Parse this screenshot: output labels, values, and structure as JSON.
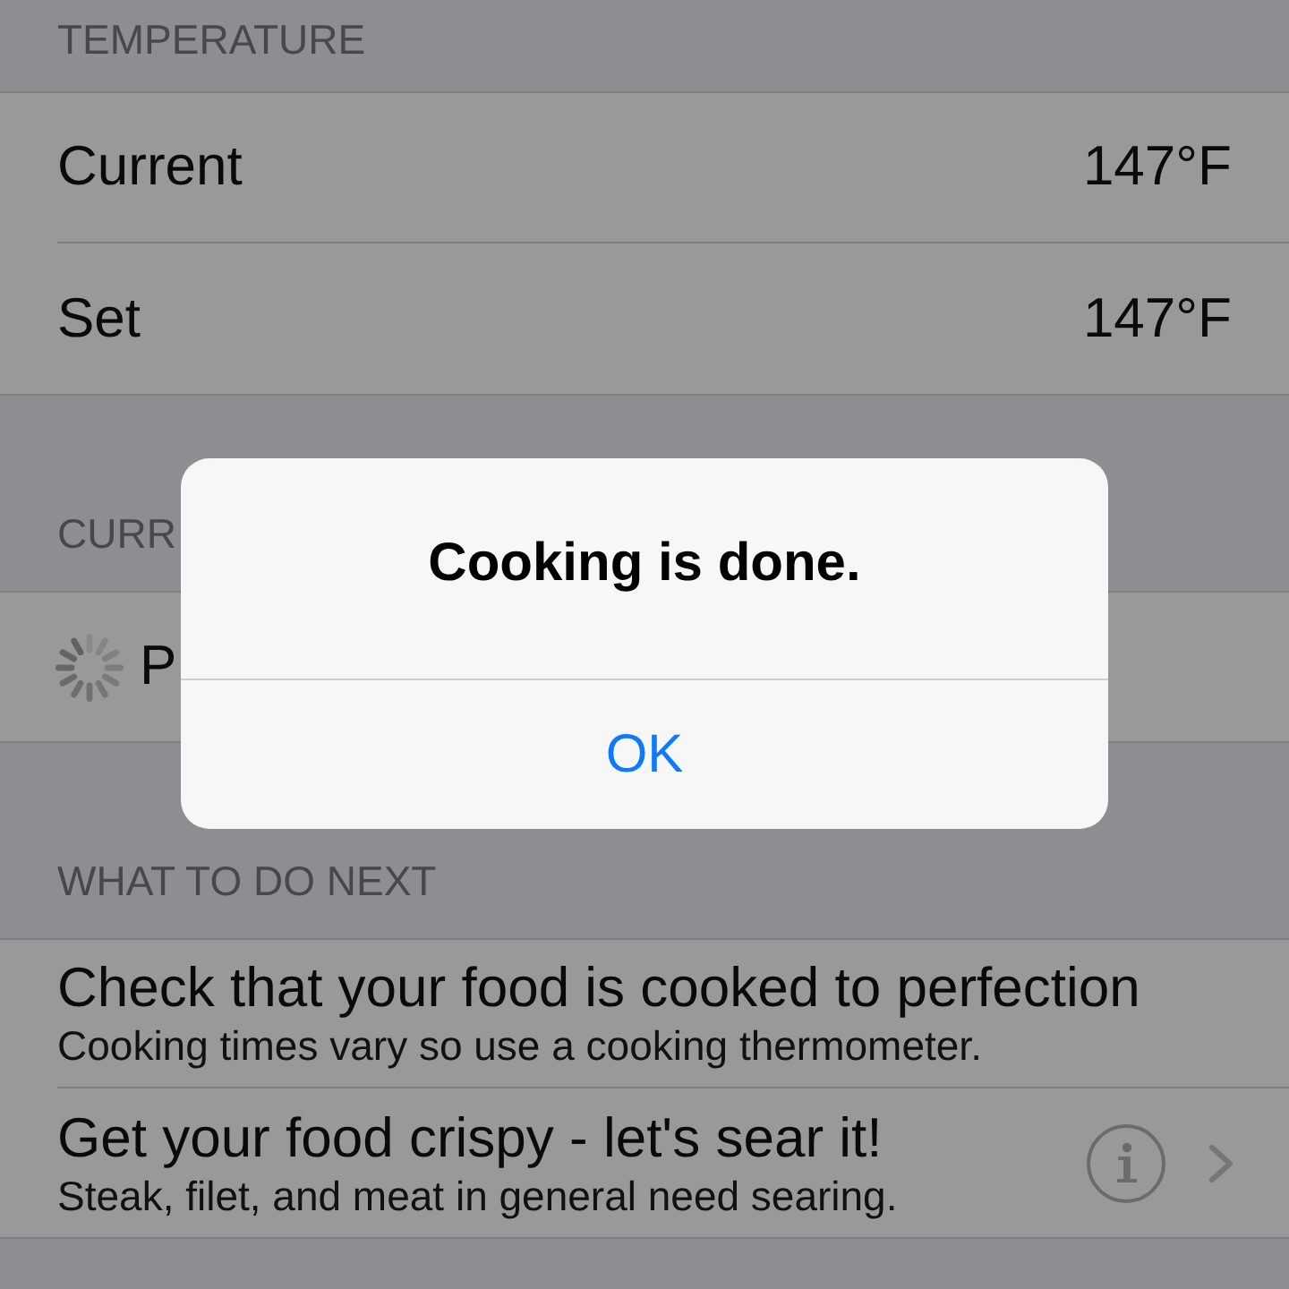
{
  "sections": [
    {
      "header": "TEMPERATURE",
      "rows": [
        {
          "kind": "value",
          "label": "Current",
          "value": "147°F"
        },
        {
          "kind": "value",
          "label": "Set",
          "value": "147°F"
        }
      ]
    },
    {
      "header": "CURR",
      "rows": [
        {
          "kind": "progress",
          "label": "P"
        }
      ]
    },
    {
      "header": "WHAT TO DO NEXT",
      "rows": [
        {
          "kind": "tip",
          "title": "Check that your food is cooked to perfection",
          "subtitle": "Cooking times vary so use a cooking thermometer.",
          "info_button": false,
          "disclosure": false
        },
        {
          "kind": "tip",
          "title": "Get your food crispy - let's sear it!",
          "subtitle": "Steak, filet, and meat in general need searing.",
          "info_button": true,
          "disclosure": true
        }
      ]
    }
  ],
  "alert": {
    "title": "Cooking is done.",
    "buttons": [
      "OK"
    ]
  }
}
